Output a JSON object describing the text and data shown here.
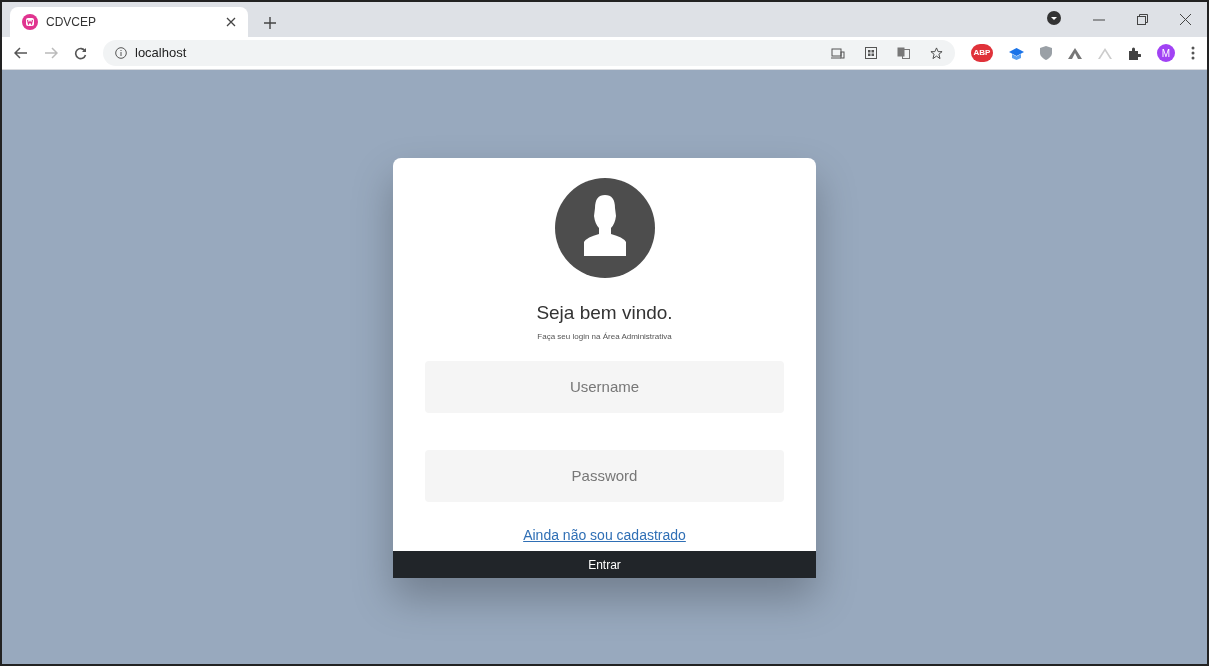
{
  "browser": {
    "tab": {
      "title": "CDVCEP",
      "selected": true
    },
    "address": "localhost",
    "extension_badge": "ABP",
    "profile_initial": "M"
  },
  "login": {
    "title": "Seja bem vindo.",
    "subtitle": "Faça seu login na Área Administrativa",
    "fields": [
      {
        "placeholder": "Username"
      },
      {
        "placeholder": "Password"
      }
    ],
    "register_link": "Ainda não sou cadastrado",
    "submit": "Entrar"
  }
}
